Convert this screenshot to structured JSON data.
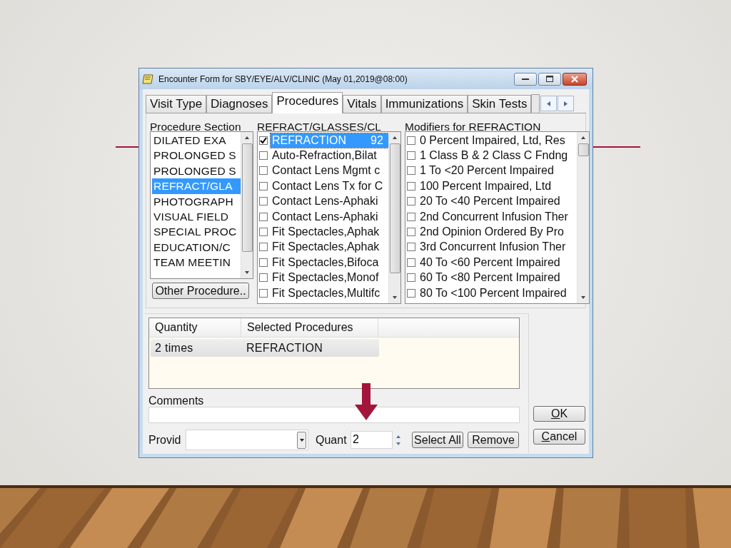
{
  "window": {
    "title": "Encounter Form for SBY/EYE/ALV/CLINIC  (May 01,2019@08:00)"
  },
  "tabs": [
    {
      "label": "Visit Type",
      "selected": false
    },
    {
      "label": "Diagnoses",
      "selected": false
    },
    {
      "label": "Procedures",
      "selected": true
    },
    {
      "label": "Vitals",
      "selected": false
    },
    {
      "label": "Immunizations",
      "selected": false
    },
    {
      "label": "Skin Tests",
      "selected": false
    }
  ],
  "procedure_section": {
    "label": "Procedure Section",
    "items": [
      {
        "label": "DILATED EXA",
        "selected": false
      },
      {
        "label": "PROLONGED S",
        "selected": false
      },
      {
        "label": "PROLONGED S",
        "selected": false
      },
      {
        "label": "REFRACT/GLA",
        "selected": true
      },
      {
        "label": "PHOTOGRAPH",
        "selected": false
      },
      {
        "label": "VISUAL FIELD",
        "selected": false
      },
      {
        "label": "SPECIAL PROC",
        "selected": false
      },
      {
        "label": "EDUCATION/C",
        "selected": false
      },
      {
        "label": "TEAM MEETIN",
        "selected": false
      }
    ]
  },
  "other_procedure_button": "Other Procedure..",
  "procedures": {
    "label": "REFRACT/GLASSES/CL",
    "items": [
      {
        "label": "REFRACTION",
        "code": "92",
        "checked": true,
        "selected": true
      },
      {
        "label": "Auto-Refraction,Bilat",
        "checked": false,
        "selected": false
      },
      {
        "label": "Contact Lens Mgmt c",
        "checked": false,
        "selected": false
      },
      {
        "label": "Contact Lens Tx for C",
        "checked": false,
        "selected": false
      },
      {
        "label": "Contact Lens-Aphaki",
        "checked": false,
        "selected": false
      },
      {
        "label": "Contact Lens-Aphaki",
        "checked": false,
        "selected": false
      },
      {
        "label": "Fit Spectacles,Aphak",
        "checked": false,
        "selected": false
      },
      {
        "label": "Fit Spectacles,Aphak",
        "checked": false,
        "selected": false
      },
      {
        "label": "Fit Spectacles,Bifoca",
        "checked": false,
        "selected": false
      },
      {
        "label": "Fit Spectacles,Monof",
        "checked": false,
        "selected": false
      },
      {
        "label": "Fit Spectacles,Multifc",
        "checked": false,
        "selected": false
      }
    ]
  },
  "modifiers": {
    "label": "Modifiers for REFRACTION",
    "items": [
      {
        "label": "0 Percent Impaired, Ltd, Res",
        "checked": false
      },
      {
        "label": "1 Class B & 2 Class C Fndng",
        "checked": false
      },
      {
        "label": "1 To <20 Percent Impaired",
        "checked": false
      },
      {
        "label": "100 Percent Impaired, Ltd",
        "checked": false
      },
      {
        "label": "20 To <40 Percent Impaired",
        "checked": false
      },
      {
        "label": "2nd Concurrent Infusion Ther",
        "checked": false
      },
      {
        "label": "2nd Opinion Ordered By Pro",
        "checked": false
      },
      {
        "label": "3rd Concurrent Infusion Ther",
        "checked": false
      },
      {
        "label": "40 To <60 Percent Impaired",
        "checked": false
      },
      {
        "label": "60 To <80 Percent Impaired",
        "checked": false
      },
      {
        "label": "80 To <100 Percent Impaired",
        "checked": false
      }
    ]
  },
  "selected_table": {
    "columns": [
      "Quantity",
      "Selected Procedures"
    ],
    "rows": [
      {
        "cells": [
          "2 times",
          "REFRACTION"
        ],
        "selected": true
      }
    ]
  },
  "comments": {
    "label": "Comments"
  },
  "provider": {
    "label": "Provid"
  },
  "quantity": {
    "label": "Quant",
    "value": "2"
  },
  "buttons": {
    "select_all": "Select All",
    "remove": "Remove",
    "ok": "OK",
    "cancel": "Cancel"
  }
}
